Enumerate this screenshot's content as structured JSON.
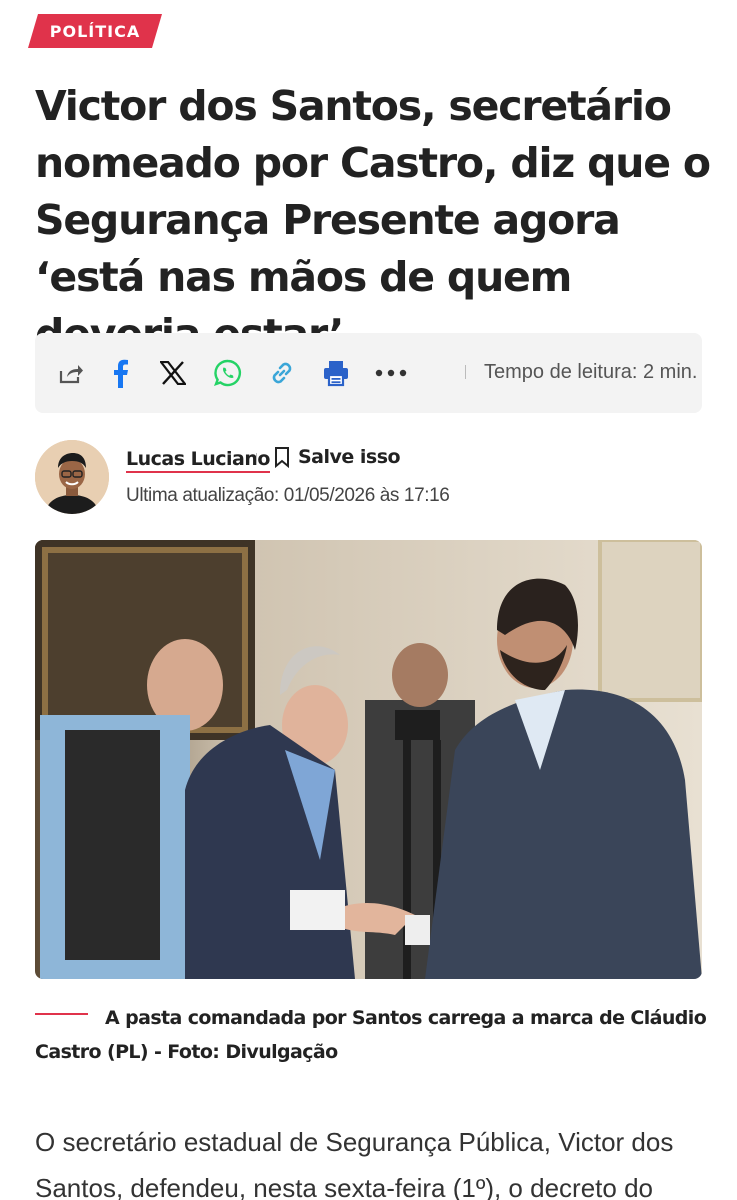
{
  "category": "POLÍTICA",
  "headline": "Victor dos Santos, secretário nomeado por Castro, diz que o Segurança Presente agora ‘está nas mãos de quem deveria estar’",
  "share_bar": {
    "icons": [
      "share-icon",
      "facebook-icon",
      "x-icon",
      "whatsapp-icon",
      "link-icon",
      "print-icon",
      "more-icon"
    ],
    "reading_time": "Tempo de leitura: 2 min."
  },
  "author": {
    "name": "Lucas Luciano",
    "save_label": "Salve isso",
    "updated": "Ultima atualização: 01/05/2026 às 17:16"
  },
  "photo": {
    "caption": "A pasta comandada por Santos carrega a marca de Cláudio Castro (PL) - Foto: Divulgação"
  },
  "article": {
    "first_paragraph": "O secretário estadual de Segurança Pública, Victor dos Santos, defendeu, nesta sexta-feira (1º), o decreto do"
  },
  "colors": {
    "accent": "#e0334b",
    "facebook": "#1877f2",
    "whatsapp": "#25d366",
    "link": "#3aa6d8",
    "print": "#2b62c9"
  }
}
